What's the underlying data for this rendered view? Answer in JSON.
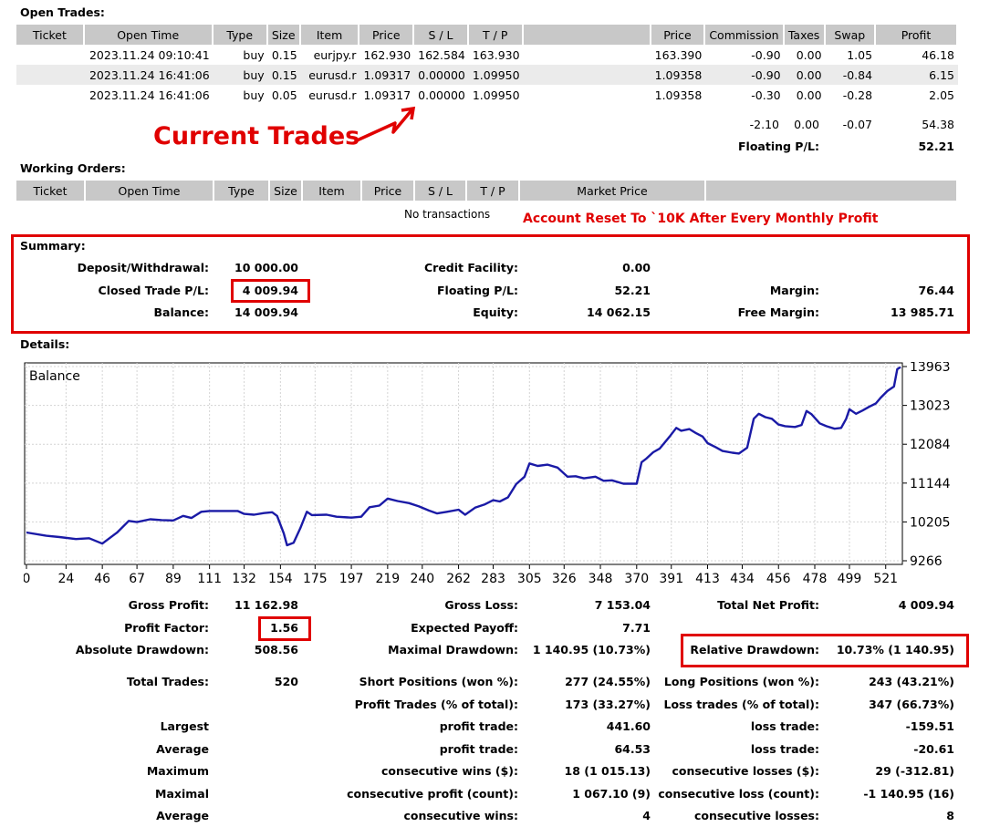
{
  "open_trades": {
    "title": "Open Trades:",
    "headers": [
      "Ticket",
      "Open Time",
      "Type",
      "Size",
      "Item",
      "Price",
      "S / L",
      "T / P",
      "",
      "Price",
      "Commission",
      "Taxes",
      "Swap",
      "Profit"
    ],
    "rows": [
      [
        "",
        "2023.11.24 09:10:41",
        "buy",
        "0.15",
        "eurjpy.r",
        "162.930",
        "162.584",
        "163.930",
        "",
        "163.390",
        "-0.90",
        "0.00",
        "1.05",
        "46.18"
      ],
      [
        "",
        "2023.11.24 16:41:06",
        "buy",
        "0.15",
        "eurusd.r",
        "1.09317",
        "0.00000",
        "1.09950",
        "",
        "1.09358",
        "-0.90",
        "0.00",
        "-0.84",
        "6.15"
      ],
      [
        "",
        "2023.11.24 16:41:06",
        "buy",
        "0.05",
        "eurusd.r",
        "1.09317",
        "0.00000",
        "1.09950",
        "",
        "1.09358",
        "-0.30",
        "0.00",
        "-0.28",
        "2.05"
      ]
    ],
    "totals": {
      "commission": "-2.10",
      "taxes": "0.00",
      "swap": "-0.07",
      "profit": "54.38"
    },
    "floating_label": "Floating P/L:",
    "floating_value": "52.21",
    "annotation": "Current Trades"
  },
  "working_orders": {
    "title": "Working Orders:",
    "headers": [
      "Ticket",
      "Open Time",
      "Type",
      "Size",
      "Item",
      "Price",
      "S / L",
      "T / P",
      "Market Price",
      ""
    ],
    "empty_text": "No transactions",
    "annotation": "Account Reset To `10K After Every Monthly Profit"
  },
  "summary": {
    "title": "Summary:",
    "deposit_label": "Deposit/Withdrawal:",
    "deposit_value": "10 000.00",
    "credit_label": "Credit Facility:",
    "credit_value": "0.00",
    "closed_label": "Closed Trade P/L:",
    "closed_value": "4 009.94",
    "floating_label": "Floating P/L:",
    "floating_value": "52.21",
    "margin_label": "Margin:",
    "margin_value": "76.44",
    "balance_label": "Balance:",
    "balance_value": "14 009.94",
    "equity_label": "Equity:",
    "equity_value": "14 062.15",
    "free_margin_label": "Free Margin:",
    "free_margin_value": "13 985.71"
  },
  "details": {
    "title": "Details:",
    "gross_profit_label": "Gross Profit:",
    "gross_profit_value": "11 162.98",
    "gross_loss_label": "Gross Loss:",
    "gross_loss_value": "7 153.04",
    "total_net_label": "Total Net Profit:",
    "total_net_value": "4 009.94",
    "profit_factor_label": "Profit Factor:",
    "profit_factor_value": "1.56",
    "expected_payoff_label": "Expected Payoff:",
    "expected_payoff_value": "7.71",
    "abs_dd_label": "Absolute Drawdown:",
    "abs_dd_value": "508.56",
    "max_dd_label": "Maximal Drawdown:",
    "max_dd_value": "1 140.95 (10.73%)",
    "rel_dd_label": "Relative Drawdown:",
    "rel_dd_value": "10.73% (1 140.95)",
    "total_trades_label": "Total Trades:",
    "total_trades_value": "520",
    "short_label": "Short Positions (won %):",
    "short_value": "277 (24.55%)",
    "long_label": "Long Positions (won %):",
    "long_value": "243 (43.21%)",
    "profit_trades_label": "Profit Trades (% of total):",
    "profit_trades_value": "173 (33.27%)",
    "loss_trades_label": "Loss trades (% of total):",
    "loss_trades_value": "347 (66.73%)",
    "largest_label": "Largest",
    "largest_profit_label": "profit trade:",
    "largest_profit_value": "441.60",
    "largest_loss_label": "loss trade:",
    "largest_loss_value": "-159.51",
    "average_label": "Average",
    "average_profit_label": "profit trade:",
    "average_profit_value": "64.53",
    "average_loss_label": "loss trade:",
    "average_loss_value": "-20.61",
    "maximum_label": "Maximum",
    "max_cons_wins_label": "consecutive wins ($):",
    "max_cons_wins_value": "18 (1 015.13)",
    "max_cons_losses_label": "consecutive losses ($):",
    "max_cons_losses_value": "29 (-312.81)",
    "maximal_label": "Maximal",
    "maximal_profit_label": "consecutive profit (count):",
    "maximal_profit_value": "1 067.10 (9)",
    "maximal_loss_label": "consecutive loss (count):",
    "maximal_loss_value": "-1 140.95 (16)",
    "average2_label": "Average",
    "avg_cons_wins_label": "consecutive wins:",
    "avg_cons_wins_value": "4",
    "avg_cons_losses_label": "consecutive losses:",
    "avg_cons_losses_value": "8"
  },
  "chart_data": {
    "type": "line",
    "legend": "Balance",
    "x_ticks": [
      "0",
      "24",
      "46",
      "67",
      "89",
      "111",
      "132",
      "154",
      "175",
      "197",
      "219",
      "240",
      "262",
      "283",
      "305",
      "326",
      "348",
      "370",
      "391",
      "413",
      "434",
      "456",
      "478",
      "499",
      "521"
    ],
    "y_ticks": [
      "13963",
      "13023",
      "12084",
      "11144",
      "10205",
      "9266"
    ],
    "ylim": [
      9266,
      13963
    ],
    "xlim": [
      0,
      530
    ],
    "series": [
      {
        "name": "Balance",
        "color": "#1a1aa6",
        "points": [
          [
            0,
            9950
          ],
          [
            12,
            9870
          ],
          [
            20,
            9840
          ],
          [
            30,
            9790
          ],
          [
            38,
            9810
          ],
          [
            46,
            9680
          ],
          [
            55,
            9950
          ],
          [
            62,
            10230
          ],
          [
            67,
            10200
          ],
          [
            75,
            10270
          ],
          [
            82,
            10250
          ],
          [
            89,
            10240
          ],
          [
            95,
            10350
          ],
          [
            100,
            10300
          ],
          [
            106,
            10450
          ],
          [
            111,
            10470
          ],
          [
            120,
            10470
          ],
          [
            128,
            10470
          ],
          [
            132,
            10400
          ],
          [
            138,
            10380
          ],
          [
            144,
            10420
          ],
          [
            149,
            10440
          ],
          [
            152,
            10350
          ],
          [
            156,
            9930
          ],
          [
            158,
            9640
          ],
          [
            162,
            9700
          ],
          [
            166,
            10050
          ],
          [
            170,
            10450
          ],
          [
            173,
            10370
          ],
          [
            182,
            10380
          ],
          [
            188,
            10330
          ],
          [
            197,
            10310
          ],
          [
            203,
            10330
          ],
          [
            208,
            10560
          ],
          [
            214,
            10600
          ],
          [
            219,
            10770
          ],
          [
            225,
            10710
          ],
          [
            232,
            10660
          ],
          [
            238,
            10580
          ],
          [
            244,
            10480
          ],
          [
            249,
            10410
          ],
          [
            255,
            10450
          ],
          [
            262,
            10500
          ],
          [
            266,
            10380
          ],
          [
            272,
            10550
          ],
          [
            278,
            10630
          ],
          [
            283,
            10730
          ],
          [
            287,
            10700
          ],
          [
            292,
            10800
          ],
          [
            297,
            11120
          ],
          [
            302,
            11300
          ],
          [
            305,
            11620
          ],
          [
            310,
            11560
          ],
          [
            316,
            11590
          ],
          [
            322,
            11520
          ],
          [
            328,
            11300
          ],
          [
            333,
            11310
          ],
          [
            338,
            11260
          ],
          [
            345,
            11300
          ],
          [
            350,
            11200
          ],
          [
            355,
            11210
          ],
          [
            362,
            11130
          ],
          [
            370,
            11130
          ],
          [
            373,
            11650
          ],
          [
            376,
            11740
          ],
          [
            380,
            11890
          ],
          [
            384,
            11980
          ],
          [
            390,
            12270
          ],
          [
            394,
            12480
          ],
          [
            397,
            12410
          ],
          [
            402,
            12450
          ],
          [
            406,
            12350
          ],
          [
            410,
            12270
          ],
          [
            413,
            12110
          ],
          [
            418,
            12010
          ],
          [
            422,
            11920
          ],
          [
            428,
            11880
          ],
          [
            432,
            11860
          ],
          [
            437,
            12000
          ],
          [
            441,
            12700
          ],
          [
            444,
            12820
          ],
          [
            448,
            12740
          ],
          [
            452,
            12700
          ],
          [
            456,
            12560
          ],
          [
            460,
            12520
          ],
          [
            466,
            12500
          ],
          [
            470,
            12550
          ],
          [
            473,
            12890
          ],
          [
            476,
            12810
          ],
          [
            481,
            12590
          ],
          [
            485,
            12520
          ],
          [
            490,
            12460
          ],
          [
            494,
            12480
          ],
          [
            497,
            12700
          ],
          [
            499,
            12930
          ],
          [
            503,
            12820
          ],
          [
            507,
            12900
          ],
          [
            511,
            12990
          ],
          [
            515,
            13070
          ],
          [
            518,
            13210
          ],
          [
            522,
            13370
          ],
          [
            526,
            13480
          ],
          [
            528,
            13900
          ],
          [
            530,
            13950
          ]
        ]
      }
    ]
  }
}
